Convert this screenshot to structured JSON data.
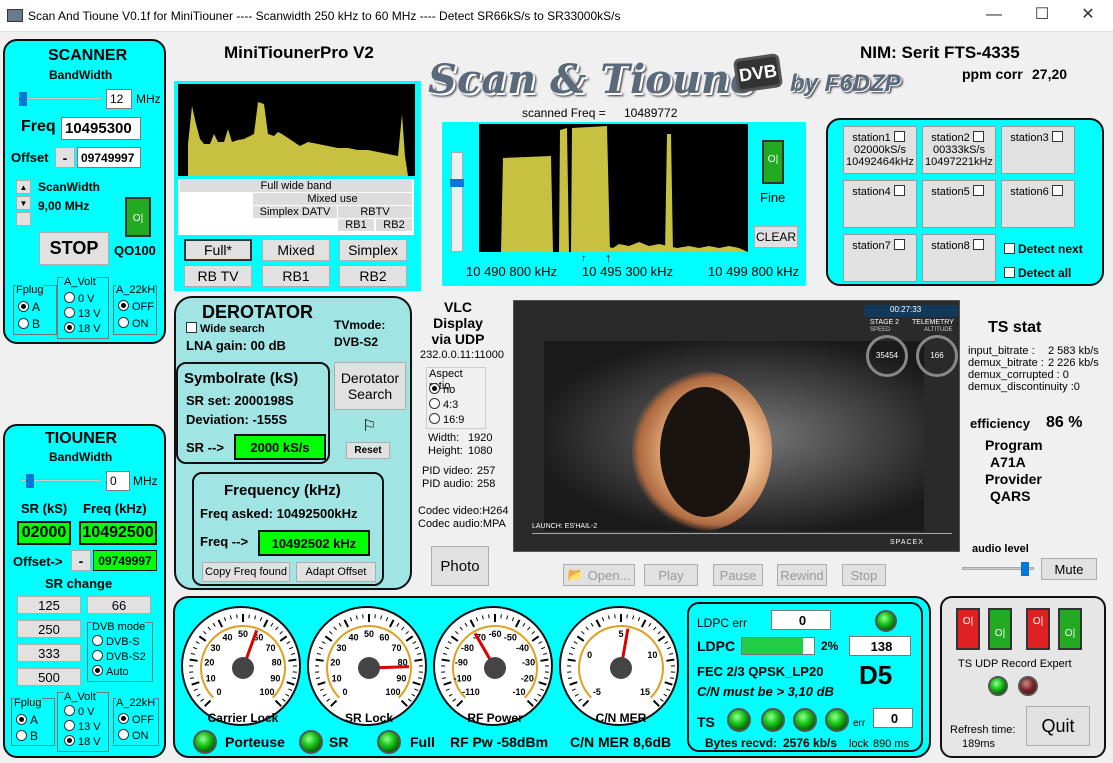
{
  "window": {
    "title": "Scan And Tioune V0.1f for MiniTiouner ---- Scanwidth 250 kHz to 60 MHz ---- Detect SR66kS/s to SR33000kS/s",
    "minimize": "—",
    "maximize": "☐",
    "close": "✕"
  },
  "header": {
    "device": "MiniTiounerPro V2",
    "nim": "NIM: Serit FTS-4335",
    "ppm_label": "ppm corr",
    "ppm_value": "27,20",
    "logo_main": "Scan & Tioune",
    "logo_dvb": "DVB",
    "logo_by": "by F6DZP"
  },
  "scanner": {
    "title": "SCANNER",
    "bandwidth_label": "BandWidth",
    "bandwidth_value": "12",
    "bandwidth_unit": "MHz",
    "freq_label": "Freq",
    "freq_value": "10495300",
    "offset_label": "Offset",
    "offset_sign": "-",
    "offset_value": "09749997",
    "scanwidth_label": "ScanWidth",
    "scanwidth_value": "9,00 MHz",
    "stop_label": "STOP",
    "qo100_label": "QO100",
    "switch_label": "O|"
  },
  "fplug1": {
    "label": "Fplug",
    "a": "A",
    "b": "B",
    "selected": "A"
  },
  "avolt1": {
    "label": "A_Volt",
    "v0": "0 V",
    "v13": "13 V",
    "v18": "18 V",
    "selected": "18 V"
  },
  "a22k1": {
    "label": "A_22kH",
    "off": "OFF",
    "on": "ON",
    "selected": "OFF"
  },
  "wide": {
    "labels": [
      "Full wide band",
      "Mixed use",
      "Simplex DATV",
      "RBTV",
      "RB1",
      "RB2"
    ],
    "buttons": [
      "Full*",
      "Mixed",
      "Simplex",
      "RB TV",
      "RB1",
      "RB2"
    ]
  },
  "spectrum": {
    "scanned_label": "scanned Freq =",
    "scanned_value": "10489772",
    "f_left": "10 490 800 kHz",
    "f_mid": "10 495 300 kHz",
    "f_right": "10 499 800 kHz",
    "fine_label": "Fine",
    "clear_label": "CLEAR"
  },
  "stations": [
    {
      "name": "station1",
      "l2": "02000kS/s",
      "l3": "10492464kHz"
    },
    {
      "name": "station2",
      "l2": "00333kS/s",
      "l3": "10497221kHz"
    },
    {
      "name": "station3",
      "l2": "",
      "l3": ""
    },
    {
      "name": "station4",
      "l2": "",
      "l3": ""
    },
    {
      "name": "station5",
      "l2": "",
      "l3": ""
    },
    {
      "name": "station6",
      "l2": "",
      "l3": ""
    },
    {
      "name": "station7",
      "l2": "",
      "l3": ""
    },
    {
      "name": "station8",
      "l2": "",
      "l3": ""
    }
  ],
  "detect": {
    "next": "Detect next",
    "all": "Detect all"
  },
  "derotator": {
    "title": "DEROTATOR",
    "wide_search": "Wide search",
    "lna": "LNA gain: 00 dB",
    "tvmode_label": "TVmode:",
    "tvmode_value": "DVB-S2",
    "sr_title": "Symbolrate (kS)",
    "sr_set": "SR set: 2000198S",
    "deviation": "Deviation: -155S",
    "sr_arrow": "SR -->",
    "sr_value": "2000 kS/s",
    "search_btn": "Derotator Search",
    "reset_btn": "Reset",
    "freq_title": "Frequency (kHz)",
    "freq_asked": "Freq asked: 10492500kHz",
    "freq_arrow": "Freq -->",
    "freq_value": "10492502 kHz",
    "copy_btn": "Copy Freq found",
    "adapt_btn": "Adapt Offset"
  },
  "vlc": {
    "title1": "VLC",
    "title2": "Display",
    "title3": "via UDP",
    "address": "232.0.0.11:11000",
    "aspect_label": "Aspect ratio",
    "aspect_no": "no",
    "aspect_43": "4:3",
    "aspect_169": "16:9",
    "aspect_selected": "no",
    "width_label": "Width:",
    "width_value": "1920",
    "height_label": "Height:",
    "height_value": "1080",
    "pid_video_label": "PID video:",
    "pid_video": "257",
    "pid_audio_label": "PID audio:",
    "pid_audio": "258",
    "codec_video": "Codec video:H264",
    "codec_audio": "Codec audio:MPA",
    "photo_btn": "Photo",
    "open_btn": "Open...",
    "play_btn": "Play",
    "pause_btn": "Pause",
    "rewind_btn": "Rewind",
    "stop_btn": "Stop"
  },
  "video": {
    "clock": "00:27:33",
    "stage": "STAGE 2",
    "telemetry": "TELEMETRY",
    "speed_label": "SPEED",
    "alt_label": "ALTITUDE",
    "speed": "35454",
    "altitude": "166",
    "launch": "LAUNCH: ES'HAIL-2",
    "spacex": "SPACEX"
  },
  "tsstat": {
    "title": "TS stat",
    "input_label": "input_bitrate :",
    "input_value": "2 583 kb/s",
    "demux_label": "demux_bitrate :",
    "demux_value": "2 226 kb/s",
    "corrupted": "demux_corrupted :  0",
    "discontinuity": "demux_discontinuity :0",
    "efficiency_label": "efficiency",
    "efficiency_value": "86 %",
    "program_label": "Program",
    "program_value": "A71A",
    "provider_label": "Provider",
    "provider_value": "QARS",
    "audio_label": "audio level",
    "audio_level": 0.92,
    "mute_btn": "Mute"
  },
  "tiouner": {
    "title": "TIOUNER",
    "bandwidth_label": "BandWidth",
    "bandwidth_value": "0",
    "bandwidth_unit": "MHz",
    "sr_label": "SR (kS)",
    "freq_label": "Freq (kHz)",
    "sr_value": "02000",
    "freq_value": "10492500",
    "offset_label": "Offset->",
    "offset_sign": "-",
    "offset_value": "09749997",
    "srchange_label": "SR change",
    "sr_buttons": [
      "125",
      "66",
      "250",
      "333",
      "500"
    ],
    "dvbmode_label": "DVB mode",
    "dvbs": "DVB-S",
    "dvbs2": "DVB-S2",
    "auto": "Auto",
    "dvb_selected": "Auto"
  },
  "fplug2": {
    "label": "Fplug",
    "a": "A",
    "b": "B",
    "selected": "A"
  },
  "avolt2": {
    "label": "A_Volt",
    "v0": "0 V",
    "v13": "13 V",
    "v18": "18 V",
    "selected": "18 V"
  },
  "a22k2": {
    "label": "A_22kH",
    "off": "OFF",
    "on": "ON",
    "selected": "OFF"
  },
  "gauges": [
    {
      "label": "Carrier Lock",
      "ticks": [
        "0",
        "10",
        "20",
        "30",
        "40",
        "50",
        "60",
        "70",
        "80",
        "90",
        "100"
      ],
      "needle_deg": 20
    },
    {
      "label": "SR Lock",
      "ticks": [
        "0",
        "10",
        "20",
        "30",
        "40",
        "50",
        "60",
        "70",
        "80",
        "90",
        "100"
      ],
      "needle_deg": 88
    },
    {
      "label": "RF Power",
      "ticks": [
        "-110",
        "-100",
        "-90",
        "-80",
        "-70",
        "-60",
        "-50",
        "-40",
        "-30",
        "-20",
        "-10"
      ],
      "needle_deg": -30
    },
    {
      "label": "C/N MER",
      "ticks": [
        "-5",
        "0",
        "5",
        "10",
        "15"
      ],
      "needle_deg": 10
    }
  ],
  "status_row": {
    "porteuse": "Porteuse",
    "sr": "SR",
    "full": "Full",
    "rfpw": "RF Pw -58dBm",
    "cnmer": "C/N MER 8,6dB"
  },
  "ldpc": {
    "err_label": "LDPC err",
    "err_value": "0",
    "ldpc_label": "LDPC",
    "ldpc_pct": "2%",
    "ldpc_fill": 0.85,
    "ldpc_count": "138",
    "fec": "FEC  2/3 QPSK_LP20",
    "d5": "D5",
    "cn_must": "C/N must be > 3,10 dB",
    "ts_label": "TS",
    "ts_err_label": "err",
    "ts_err_value": "0",
    "bytes_label": "Bytes recvd:",
    "bytes_value": "2576 kb/s",
    "lock_label": "lock",
    "lock_value": "890 ms"
  },
  "tsudp": {
    "labels": "TS UDP Record Expert",
    "refresh_label": "Refresh time:",
    "refresh_value": "189ms",
    "quit_btn": "Quit"
  },
  "colors": {
    "panel": "#00ffff",
    "panel_light": "#a0e4e4",
    "spectrum_bg": "#000000",
    "spectrum_bar": "#c8c040",
    "led": "#22cc22",
    "value_green": "#00ff00"
  }
}
